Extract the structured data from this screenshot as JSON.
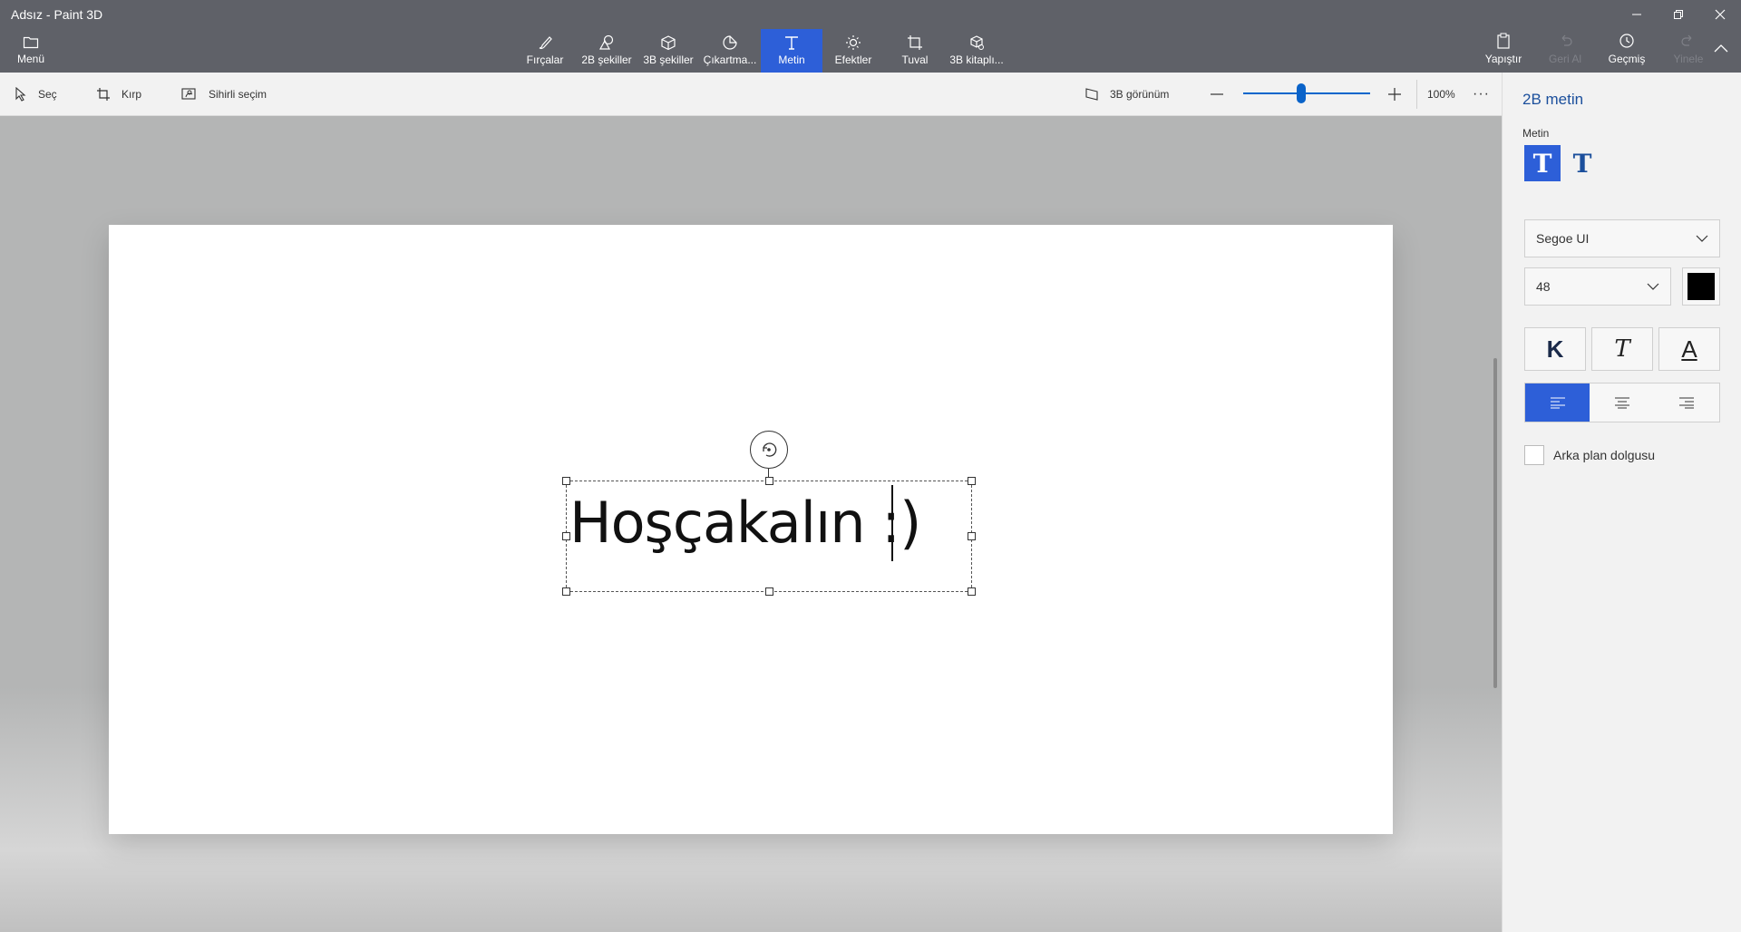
{
  "window": {
    "title": "Adsız - Paint 3D",
    "minimize_icon": "minimize-icon",
    "restore_icon": "restore-icon",
    "close_icon": "close-icon"
  },
  "ribbon": {
    "menu_label": "Menü",
    "tools": [
      {
        "label": "Fırçalar",
        "icon": "brush-icon"
      },
      {
        "label": "2B şekiller",
        "icon": "2d-shapes-icon"
      },
      {
        "label": "3B şekiller",
        "icon": "3d-shapes-icon"
      },
      {
        "label": "Çıkartma...",
        "icon": "sticker-icon"
      },
      {
        "label": "Metin",
        "icon": "text-icon",
        "active": true
      },
      {
        "label": "Efektler",
        "icon": "effects-icon"
      },
      {
        "label": "Tuval",
        "icon": "canvas-icon"
      },
      {
        "label": "3B kitaplı...",
        "icon": "3d-library-icon"
      }
    ],
    "paste_label": "Yapıştır",
    "undo_label": "Geri Al",
    "history_label": "Geçmiş",
    "redo_label": "Yinele"
  },
  "toolbar": {
    "select_label": "Seç",
    "crop_label": "Kırp",
    "magic_select_label": "Sihirli seçim",
    "view3d_label": "3B görünüm",
    "zoom_level": "100%",
    "zoom_fraction": 0.46,
    "more_label": "···"
  },
  "canvas": {
    "text": "Hoşçakalın :)"
  },
  "panel": {
    "title": "2B metin",
    "section_label": "Metin",
    "font": "Segoe UI",
    "size": "48",
    "text_color": "#000000",
    "bold_label": "K",
    "italic_label": "T",
    "underline_label": "A",
    "background_fill_label": "Arka plan dolgusu",
    "accent_color": "#2d5fd8"
  }
}
